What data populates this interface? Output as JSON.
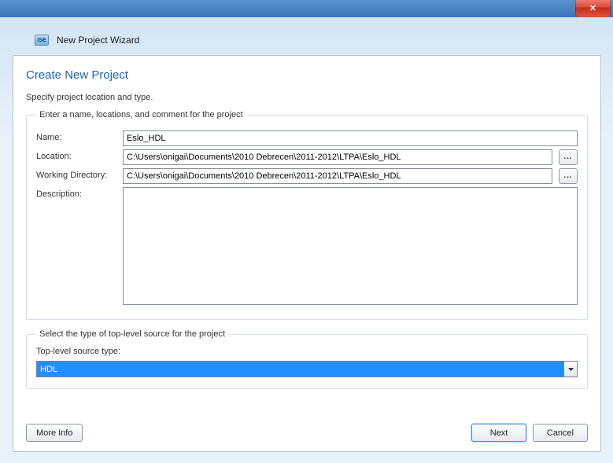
{
  "window": {
    "close_glyph": "✕"
  },
  "header": {
    "icon_text": "ISE",
    "title": "New Project Wizard"
  },
  "page": {
    "title": "Create New Project",
    "subtitle": "Specify project location and type."
  },
  "group1": {
    "legend": "Enter a name, locations, and comment for the project",
    "name_label": "Name:",
    "name_value": "Eslo_HDL",
    "location_label": "Location:",
    "location_value": "C:\\Users\\onigai\\Documents\\2010 Debrecen\\2011-2012\\LTPA\\Eslo_HDL",
    "working_dir_label": "Working Directory:",
    "working_dir_value": "C:\\Users\\onigai\\Documents\\2010 Debrecen\\2011-2012\\LTPA\\Eslo_HDL",
    "description_label": "Description:",
    "description_value": "",
    "browse_glyph": "..."
  },
  "group2": {
    "legend": "Select the type of top-level source for the project",
    "type_label": "Top-level source type:",
    "type_value": "HDL"
  },
  "footer": {
    "more_info": "More Info",
    "next": "Next",
    "cancel": "Cancel"
  }
}
